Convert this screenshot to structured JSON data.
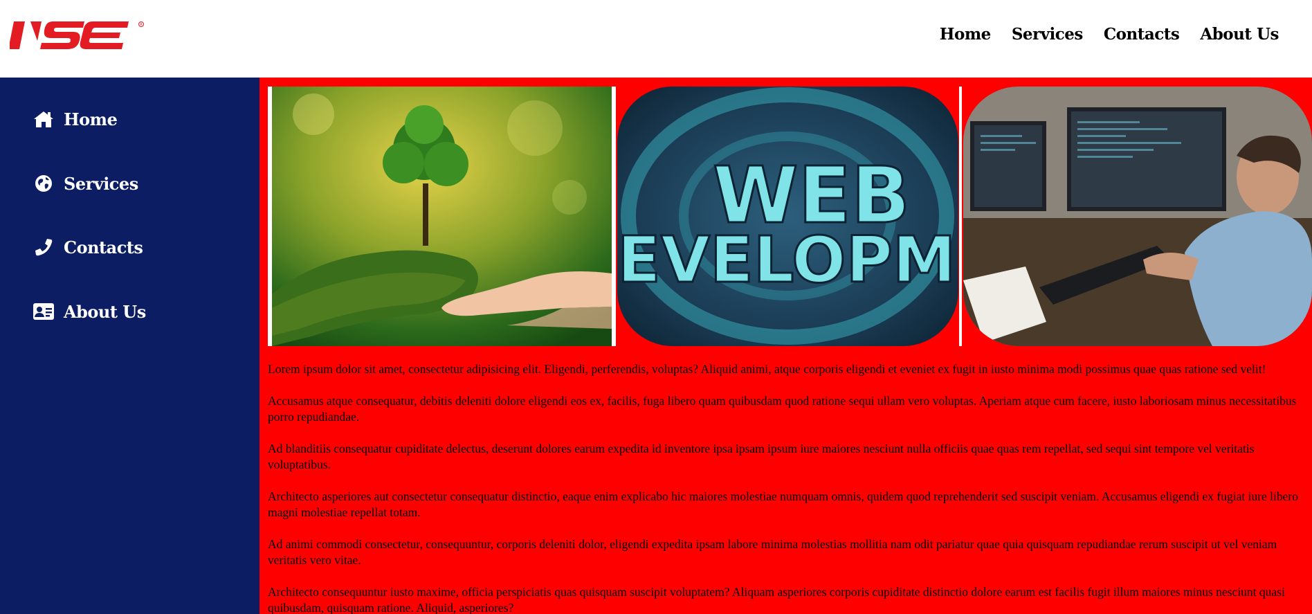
{
  "header": {
    "logo_text": "IJSE",
    "nav": [
      {
        "label": "Home"
      },
      {
        "label": "Services"
      },
      {
        "label": "Contacts"
      },
      {
        "label": "About Us"
      }
    ]
  },
  "sidebar": {
    "items": [
      {
        "label": "Home",
        "icon": "home-icon"
      },
      {
        "label": "Services",
        "icon": "globe-icon"
      },
      {
        "label": "Contacts",
        "icon": "phone-icon"
      },
      {
        "label": "About Us",
        "icon": "id-card-icon"
      }
    ]
  },
  "gallery": {
    "images": [
      {
        "name": "tree-in-hands-image"
      },
      {
        "name": "web-development-image",
        "text": "WEB",
        "text2": "EVELOPME"
      },
      {
        "name": "developer-at-desk-image"
      }
    ]
  },
  "content": {
    "paragraphs": [
      "Lorem ipsum dolor sit amet, consectetur adipisicing elit. Eligendi, perferendis, voluptas? Aliquid animi, atque corporis eligendi et eveniet ex fugit in iusto minima modi possimus quae quas ratione sed velit!",
      "Accusamus atque consequatur, debitis deleniti dolore eligendi eos ex, facilis, fuga libero quam quibusdam quod ratione sequi ullam vero voluptas. Aperiam atque cum facere, iusto laboriosam minus necessitatibus porro repudiandae.",
      "Ad blanditiis consequatur cupiditate delectus, deserunt dolores earum expedita id inventore ipsa ipsam ipsum iure maiores nesciunt nulla officiis quae quas rem repellat, sed sequi sint tempore vel veritatis voluptatibus.",
      "Architecto asperiores aut consectetur consequatur distinctio, eaque enim explicabo hic maiores molestiae numquam omnis, quidem quod reprehenderit sed suscipit veniam. Accusamus eligendi ex fugiat iure libero magni molestiae repellat totam.",
      "Ad animi commodi consectetur, consequuntur, corporis deleniti dolor, eligendi expedita ipsam labore minima molestias mollitia nam odit pariatur quae quia quisquam repudiandae rerum suscipit ut vel veniam veritatis vero vitae.",
      "Architecto consequuntur iusto maxime, officia perspiciatis quas quisquam suscipit voluptatem? Aliquam asperiores corporis cupiditate distinctio dolore earum est facilis fugit illum maiores minus nesciunt quasi quibusdam, quisquam ratione. Aliquid, asperiores?"
    ]
  },
  "colors": {
    "brand_red": "#e31b23",
    "sidebar_bg": "#0c1d64",
    "main_bg": "#ff0000"
  }
}
